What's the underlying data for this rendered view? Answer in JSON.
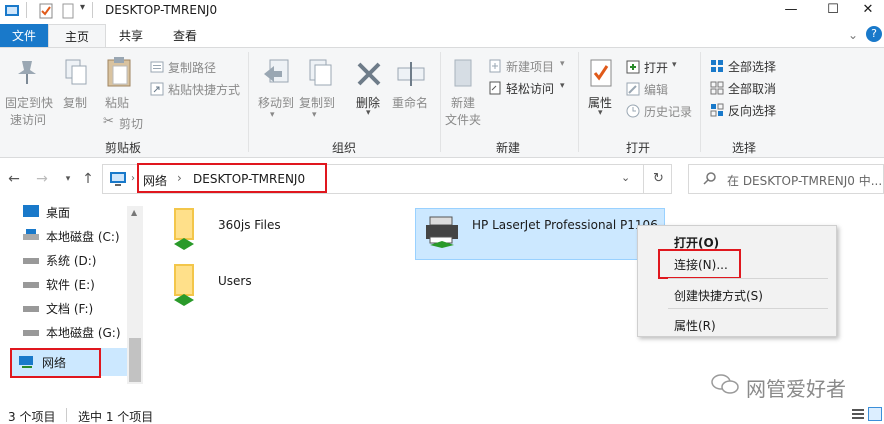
{
  "window": {
    "title": "DESKTOP-TMRENJ0",
    "controls": [
      "—",
      "☐",
      "✕"
    ]
  },
  "tabs": {
    "file": "文件",
    "home": "主页",
    "share": "共享",
    "view": "查看",
    "help": "?"
  },
  "ribbon": {
    "clipboard": {
      "label": "剪贴板",
      "pin": "固定到快速访问",
      "pin_line1": "固定到快",
      "pin_line2": "速访问",
      "copy": "复制",
      "paste": "粘贴",
      "copy_path": "复制路径",
      "paste_shortcut": "粘贴快捷方式",
      "cut": "剪切"
    },
    "organize": {
      "label": "组织",
      "move_to": "移动到",
      "copy_to": "复制到",
      "delete": "删除",
      "rename": "重命名"
    },
    "new": {
      "label": "新建",
      "new_folder_line1": "新建",
      "new_folder_line2": "文件夹",
      "new_item": "新建项目",
      "easy_access": "轻松访问"
    },
    "open": {
      "label": "打开",
      "properties": "属性",
      "open": "打开",
      "edit": "编辑",
      "history": "历史记录"
    },
    "select": {
      "label": "选择",
      "select_all": "全部选择",
      "select_none": "全部取消",
      "invert": "反向选择"
    }
  },
  "address": {
    "back": "←",
    "forward": "→",
    "up": "↑",
    "root": "网络",
    "current": "DESKTOP-TMRENJ0",
    "refresh": "↻",
    "search_placeholder": "在 DESKTOP-TMRENJ0 中..."
  },
  "nav": {
    "items": [
      {
        "label": "桌面"
      },
      {
        "label": "本地磁盘 (C:)"
      },
      {
        "label": "系统 (D:)"
      },
      {
        "label": "软件 (E:)"
      },
      {
        "label": "文档 (F:)"
      },
      {
        "label": "本地磁盘 (G:)"
      },
      {
        "label": "网络"
      }
    ]
  },
  "files": [
    {
      "name": "360js Files"
    },
    {
      "name": "Users"
    },
    {
      "name": "HP LaserJet Professional P1106"
    }
  ],
  "context_menu": {
    "items": [
      "打开(O)",
      "连接(N)...",
      "创建快捷方式(S)",
      "属性(R)"
    ]
  },
  "status": {
    "count": "3 个项目",
    "selected": "选中 1 个项目"
  },
  "watermark": "网管爱好者",
  "colors": {
    "accent": "#1979ca",
    "highlight": "#e0171e",
    "selection": "#cce8ff"
  }
}
